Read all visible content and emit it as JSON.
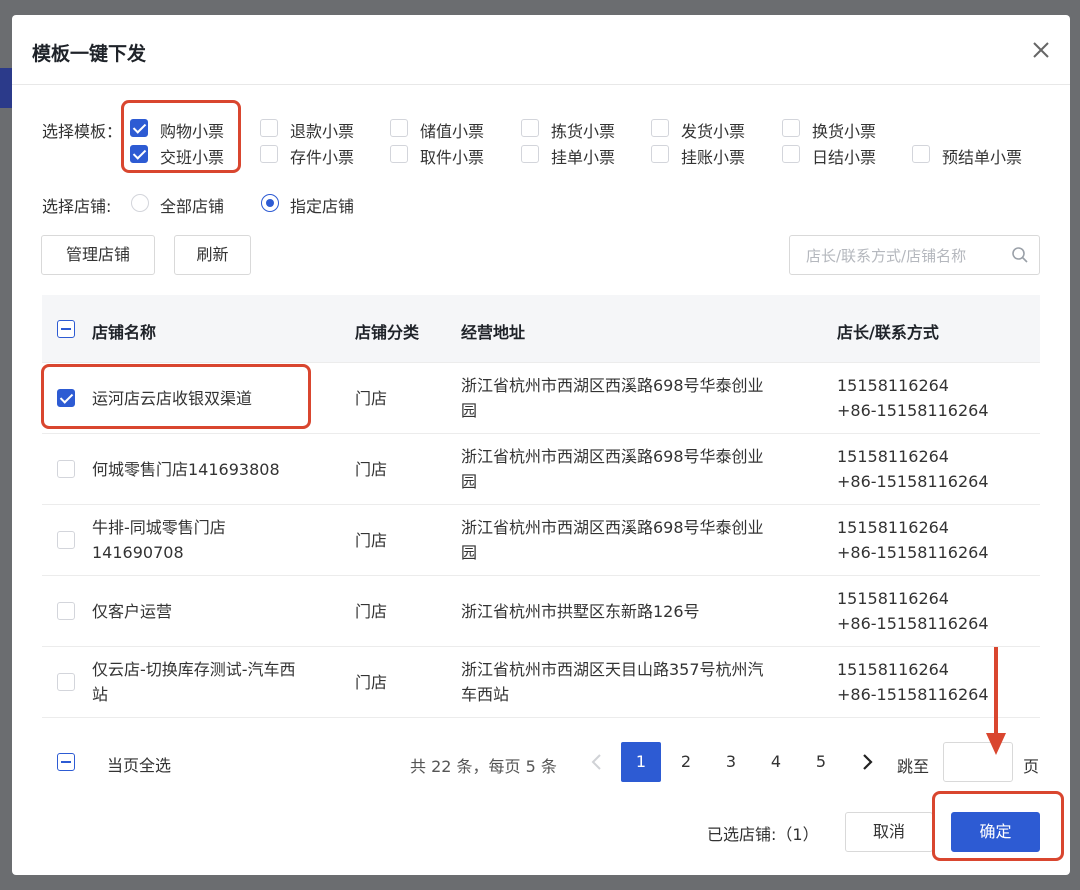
{
  "dialog": {
    "title": "模板一键下发"
  },
  "templates": {
    "label": "选择模板：",
    "row1": [
      {
        "label": "购物小票",
        "checked": true
      },
      {
        "label": "退款小票",
        "checked": false
      },
      {
        "label": "储值小票",
        "checked": false
      },
      {
        "label": "拣货小票",
        "checked": false
      },
      {
        "label": "发货小票",
        "checked": false
      },
      {
        "label": "换货小票",
        "checked": false
      }
    ],
    "row2": [
      {
        "label": "交班小票",
        "checked": true
      },
      {
        "label": "存件小票",
        "checked": false
      },
      {
        "label": "取件小票",
        "checked": false
      },
      {
        "label": "挂单小票",
        "checked": false
      },
      {
        "label": "挂账小票",
        "checked": false
      },
      {
        "label": "日结小票",
        "checked": false
      },
      {
        "label": "预结单小票",
        "checked": false
      }
    ]
  },
  "stores": {
    "label": "选择店铺:",
    "options": [
      {
        "label": "全部店铺",
        "checked": false
      },
      {
        "label": "指定店铺",
        "checked": true
      }
    ]
  },
  "toolbar": {
    "manage_label": "管理店铺",
    "refresh_label": "刷新",
    "search_placeholder": "店长/联系方式/店铺名称"
  },
  "table": {
    "headers": [
      "店铺名称",
      "店铺分类",
      "经营地址",
      "店长/联系方式"
    ],
    "rows": [
      {
        "checked": true,
        "name": [
          "运河店云店收银双渠道"
        ],
        "category": "门店",
        "address": [
          "浙江省杭州市西湖区西溪路698号华泰创业",
          "园"
        ],
        "contact": [
          "15158116264",
          "+86-15158116264"
        ]
      },
      {
        "checked": false,
        "name": [
          "何城零售门店141693808"
        ],
        "category": "门店",
        "address": [
          "浙江省杭州市西湖区西溪路698号华泰创业",
          "园"
        ],
        "contact": [
          "15158116264",
          "+86-15158116264"
        ]
      },
      {
        "checked": false,
        "name": [
          "牛排-同城零售门店",
          "141690708"
        ],
        "category": "门店",
        "address": [
          "浙江省杭州市西湖区西溪路698号华泰创业",
          "园"
        ],
        "contact": [
          "15158116264",
          "+86-15158116264"
        ]
      },
      {
        "checked": false,
        "name": [
          "仅客户运营"
        ],
        "category": "门店",
        "address": [
          "浙江省杭州市拱墅区东新路126号"
        ],
        "contact": [
          "15158116264",
          "+86-15158116264"
        ]
      },
      {
        "checked": false,
        "name": [
          "仅云店-切换库存测试-汽车西",
          "站"
        ],
        "category": "门店",
        "address": [
          "浙江省杭州市西湖区天目山路357号杭州汽",
          "车西站"
        ],
        "contact": [
          "15158116264",
          "+86-15158116264"
        ]
      }
    ]
  },
  "footer": {
    "select_all_label": "当页全选",
    "total_text": "共 22 条，每页 5 条",
    "pages": [
      "1",
      "2",
      "3",
      "4",
      "5"
    ],
    "current_page": "1",
    "jump_label": "跳至",
    "page_unit": "页",
    "selected_text": "已选店铺:（1）",
    "cancel_label": "取消",
    "confirm_label": "确定"
  },
  "colors": {
    "primary": "#2d5bd3",
    "annotation_red": "#d9462f"
  }
}
